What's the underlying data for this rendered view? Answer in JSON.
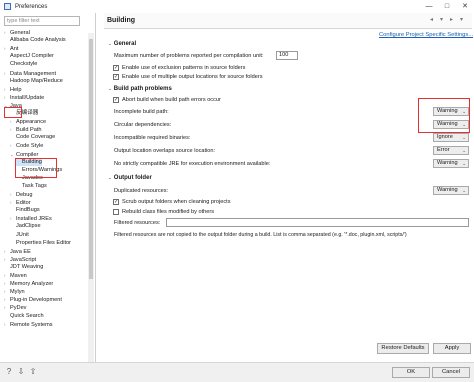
{
  "window": {
    "title": "Preferences",
    "minimize": "—",
    "maximize": "□",
    "close": "✕"
  },
  "sidebar": {
    "filter_placeholder": "type filter text",
    "items": [
      {
        "label": "General",
        "twisty": "›"
      },
      {
        "label": "Alibaba Code Analysis",
        "twisty": ""
      },
      {
        "label": "Ant",
        "twisty": "›"
      },
      {
        "label": "AspectJ Compiler",
        "twisty": ""
      },
      {
        "label": "Checkstyle",
        "twisty": ""
      },
      {
        "label": "Data Management",
        "twisty": "›"
      },
      {
        "label": "Hadoop Map/Reduce",
        "twisty": ""
      },
      {
        "label": "Help",
        "twisty": "›"
      },
      {
        "label": "Install/Update",
        "twisty": "›"
      },
      {
        "label": "Java",
        "twisty": "⌄"
      },
      {
        "label": "反编译器",
        "twisty": ""
      },
      {
        "label": "Appearance",
        "twisty": "›"
      },
      {
        "label": "Build Path",
        "twisty": "›"
      },
      {
        "label": "Code Coverage",
        "twisty": ""
      },
      {
        "label": "Code Style",
        "twisty": "›"
      },
      {
        "label": "Compiler",
        "twisty": "⌄"
      },
      {
        "label": "Building",
        "twisty": ""
      },
      {
        "label": "Errors/Warnings",
        "twisty": ""
      },
      {
        "label": "Javadoc",
        "twisty": ""
      },
      {
        "label": "Task Tags",
        "twisty": ""
      },
      {
        "label": "Debug",
        "twisty": "›"
      },
      {
        "label": "Editor",
        "twisty": "›"
      },
      {
        "label": "FindBugs",
        "twisty": ""
      },
      {
        "label": "Installed JREs",
        "twisty": "›"
      },
      {
        "label": "JadClipse",
        "twisty": ""
      },
      {
        "label": "JUnit",
        "twisty": ""
      },
      {
        "label": "Properties Files Editor",
        "twisty": ""
      },
      {
        "label": "Java EE",
        "twisty": "›"
      },
      {
        "label": "JavaScript",
        "twisty": "›"
      },
      {
        "label": "JDT Weaving",
        "twisty": ""
      },
      {
        "label": "Maven",
        "twisty": "›"
      },
      {
        "label": "Memory Analyzer",
        "twisty": "›"
      },
      {
        "label": "Mylyn",
        "twisty": "›"
      },
      {
        "label": "Plug-in Development",
        "twisty": "›"
      },
      {
        "label": "PyDev",
        "twisty": "›"
      },
      {
        "label": "Quick Search",
        "twisty": ""
      },
      {
        "label": "Remote Systems",
        "twisty": "›"
      }
    ]
  },
  "page": {
    "title": "Building",
    "configure_link": "Configure Project Specific Settings...",
    "general": {
      "title": "General",
      "max_problems_label": "Maximum number of problems reported per compilation unit:",
      "max_problems_value": "100",
      "exclusion_label": "Enable use of exclusion patterns in source folders",
      "multiple_output_label": "Enable use of multiple output locations for source folders"
    },
    "build_path": {
      "title": "Build path problems",
      "abort_label": "Abort build when build path errors occur",
      "incomplete_label": "Incomplete build path:",
      "incomplete_value": "Warning",
      "circular_label": "Circular dependencies:",
      "circular_value": "Warning",
      "incompatible_label": "Incompatible required binaries:",
      "incompatible_value": "Ignore",
      "overlap_label": "Output location overlaps source location:",
      "overlap_value": "Error",
      "jre_label": "No strictly compatible JRE for execution environment available:",
      "jre_value": "Warning"
    },
    "output": {
      "title": "Output folder",
      "duplicated_label": "Duplicated resources:",
      "duplicated_value": "Warning",
      "scrub_label": "Scrub output folders when cleaning projects",
      "rebuild_label": "Rebuild class files modified by others",
      "filtered_label": "Filtered resources:",
      "filtered_note": "Filtered resources are not copied to the output folder during a build. List is comma separated (e.g. '*.doc, plugin.xml, scripts/')"
    },
    "restore_label": "Restore Defaults",
    "apply_label": "Apply",
    "ok_label": "OK",
    "cancel_label": "Cancel"
  },
  "icons": {
    "help": "?",
    "import": "⇩",
    "export": "⇧"
  },
  "colors": {
    "annotation": "#e53030",
    "selection": "#cde3f8",
    "link": "#1a5fb4"
  }
}
